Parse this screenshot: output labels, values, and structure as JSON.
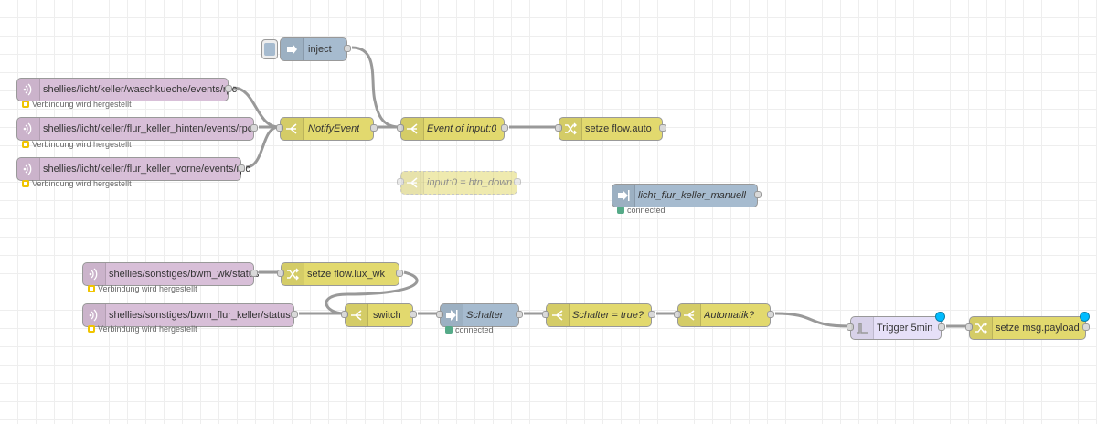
{
  "colors": {
    "mqtt": "#d8bfd8",
    "function": "#e2d96e",
    "change": "#e2d96e",
    "inject": "#a6bbcf",
    "ha": "#a6bbcf",
    "trigger": "#e6e0f8",
    "wire": "#999999",
    "status_connecting": "#f0c400",
    "status_connected": "#55aa88",
    "changed_marker": "#00bcff"
  },
  "nodes": [
    {
      "id": "inject",
      "label": "inject",
      "type": "inject",
      "icon": "arrow-right-icon"
    },
    {
      "id": "mqtt1",
      "label": "shellies/licht/keller/waschkueche/events/rpc",
      "type": "mqtt-in",
      "icon": "broadcast-icon",
      "status": "Verbindung wird hergestellt"
    },
    {
      "id": "mqtt2",
      "label": "shellies/licht/keller/flur_keller_hinten/events/rpc",
      "type": "mqtt-in",
      "icon": "broadcast-icon",
      "status": "Verbindung wird hergestellt"
    },
    {
      "id": "mqtt3",
      "label": "shellies/licht/keller/flur_keller_vorne/events/rpc",
      "type": "mqtt-in",
      "icon": "broadcast-icon",
      "status": "Verbindung wird hergestellt"
    },
    {
      "id": "notify",
      "label": "NotifyEvent",
      "type": "switch",
      "icon": "switch-icon"
    },
    {
      "id": "event",
      "label": "Event of input:0",
      "type": "switch",
      "icon": "switch-icon"
    },
    {
      "id": "setzeauto",
      "label": "setze flow.auto",
      "type": "change",
      "icon": "shuffle-icon"
    },
    {
      "id": "input0",
      "label": "input:0 = btn_down",
      "type": "switch",
      "icon": "switch-icon"
    },
    {
      "id": "manuell",
      "label": "licht_flur_keller_manuell",
      "type": "ha",
      "icon": "arrow-into-icon",
      "status": "connected"
    },
    {
      "id": "bwm_wk",
      "label": "shellies/sonstiges/bwm_wk/status",
      "type": "mqtt-in",
      "icon": "broadcast-icon",
      "status": "Verbindung wird hergestellt"
    },
    {
      "id": "setzelux",
      "label": "setze flow.lux_wk",
      "type": "change",
      "icon": "shuffle-icon"
    },
    {
      "id": "bwm_flur",
      "label": "shellies/sonstiges/bwm_flur_keller/status",
      "type": "mqtt-in",
      "icon": "broadcast-icon",
      "status": "Verbindung wird hergestellt"
    },
    {
      "id": "switch",
      "label": "switch",
      "type": "switch",
      "icon": "switch-icon"
    },
    {
      "id": "schalter",
      "label": "Schalter",
      "type": "ha",
      "icon": "arrow-into-icon",
      "status": "connected"
    },
    {
      "id": "schalter_true",
      "label": "Schalter = true?",
      "type": "switch",
      "icon": "switch-icon"
    },
    {
      "id": "automatik",
      "label": "Automatik?",
      "type": "switch",
      "icon": "switch-icon"
    },
    {
      "id": "trigger",
      "label": "Trigger 5min",
      "type": "trigger",
      "icon": "trigger-icon"
    },
    {
      "id": "setzepayload",
      "label": "setze msg.payload",
      "type": "change",
      "icon": "shuffle-icon"
    }
  ]
}
